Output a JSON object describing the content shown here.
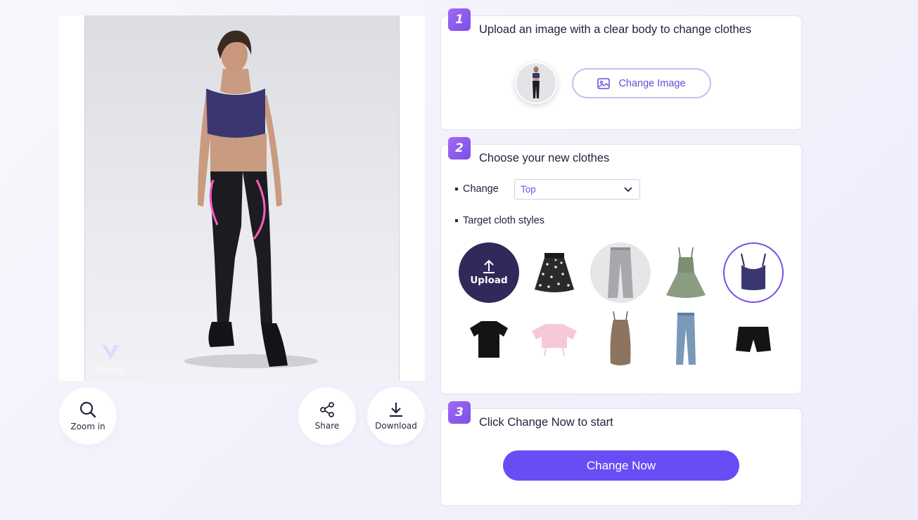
{
  "preview": {
    "watermark": "Vidnoz",
    "tools": {
      "zoom_in": "Zoom in",
      "share": "Share",
      "download": "Download"
    }
  },
  "step1": {
    "number": "1",
    "title": "Upload an image with a clear body to change clothes",
    "change_image_label": "Change Image"
  },
  "step2": {
    "number": "2",
    "title": "Choose your new clothes",
    "change_label": "Change",
    "change_select_value": "Top",
    "styles_label": "Target cloth styles",
    "upload_label": "Upload",
    "selected_style": "navy-crop-top"
  },
  "step3": {
    "number": "3",
    "title": "Click Change Now to start",
    "button_label": "Change Now"
  },
  "colors": {
    "accent": "#6a4cf5",
    "badge": "#8b5cf0",
    "upload_bg": "#2f2a5a",
    "select_text": "#7a4fe0"
  }
}
